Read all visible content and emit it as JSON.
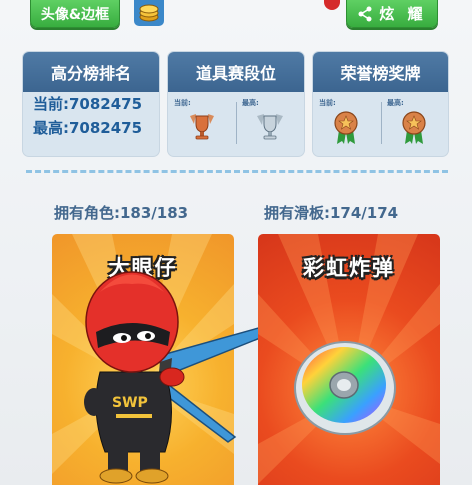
{
  "topbar": {
    "avatar_frame_label": "头像&边框",
    "share_label": "炫 耀",
    "coin_icon": "coin-stack-icon",
    "share_icon": "share-icon"
  },
  "cards": {
    "high_score": {
      "title": "高分榜排名",
      "current": "当前:7082475",
      "best": "最高:7082475"
    },
    "item_tier": {
      "title": "道具赛段位",
      "current_label": "当前:",
      "best_label": "最高:",
      "current_badge": "bronze-trophy-badge-icon",
      "best_badge": "silver-trophy-badge-icon"
    },
    "honor": {
      "title": "荣誉榜奖牌",
      "current_label": "当前:",
      "best_label": "最高:",
      "current_medal": "bronze-star-medal-icon",
      "best_medal": "bronze-star-medal-icon"
    }
  },
  "ownership": {
    "characters": "拥有角色:183/183",
    "boards": "拥有滑板:174/174"
  },
  "featured": {
    "character_name": "大眼仔",
    "board_name": "彩虹炸弹"
  },
  "colors": {
    "accent_green": "#38ad3f",
    "header_blue": "#3c6590",
    "score_blue": "#1f5d99",
    "orange_card": "#f7b12e",
    "red_card": "#ea4b1f"
  }
}
